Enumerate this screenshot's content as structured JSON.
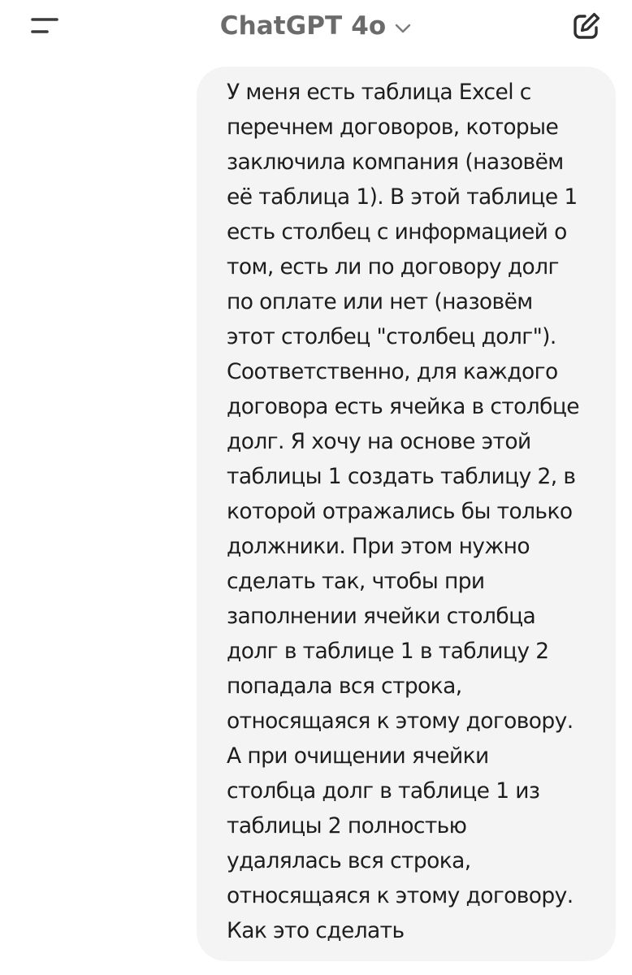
{
  "header": {
    "menu_icon": "menu-icon",
    "title": "ChatGPT 4o",
    "chevron_icon": "chevron-down-icon",
    "new_chat_icon": "edit-icon"
  },
  "conversation": {
    "user_message": "У меня есть таблица Excel с\nперечнем договоров, которые\nзаключила компания (назовём\neё таблица 1). В этой таблице 1\nесть столбец с информацией о\nтом, есть ли по договору долг\nпо оплате или нет (назовём\nэтот столбец \"столбец долг\").\nСоответственно, для каждого\nдоговора есть ячейка в столбце\nдолг. Я хочу на основе этой\nтаблицы 1 создать таблицу 2, в\nкоторой отражались бы только\nдолжники. При этом нужно\nсделать так, чтобы при\nзаполнении ячейки столбца\nдолг в таблице 1 в таблицу 2\nпопадала вся строка,\nотносящаяся к этому договору.\nА при очищении ячейки\nстолбца долг в таблице 1 из\nтаблицы 2 полностью\nудалялась вся строка,\nотносящаяся к этому договору.\nКак это сделать"
  },
  "colors": {
    "bubble_background": "#f4f4f4",
    "title_text": "#6b6b6b",
    "icon": "#3a3a3a"
  }
}
